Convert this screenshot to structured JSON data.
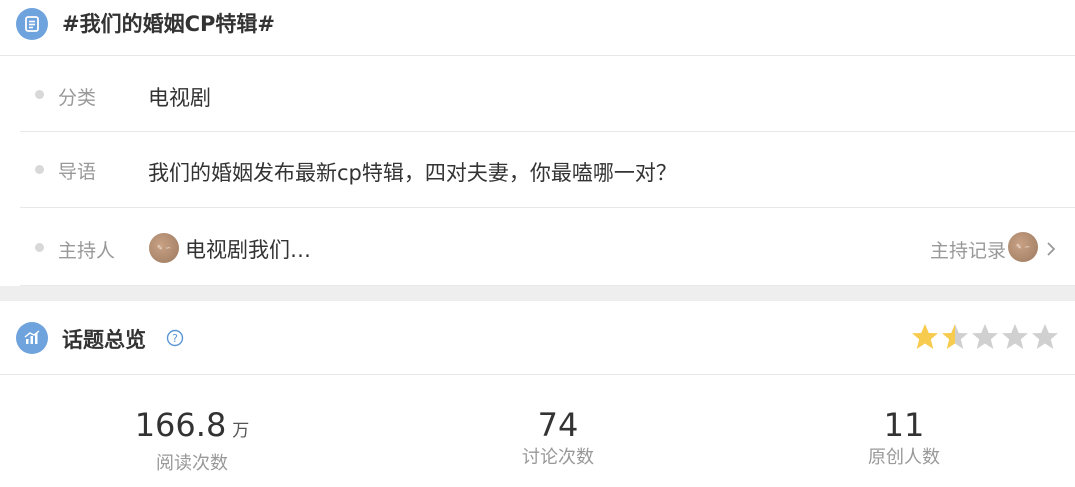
{
  "topic": {
    "title": "#我们的婚姻CP特辑#"
  },
  "info": {
    "category": {
      "label": "分类",
      "value": "电视剧"
    },
    "intro": {
      "label": "导语",
      "value": "我们的婚姻发布最新cp特辑，四对夫妻，你最嗑哪一对？"
    },
    "host": {
      "label": "主持人",
      "name": "电视剧我们…",
      "record_link": "主持记录"
    }
  },
  "overview": {
    "title": "话题总览",
    "rating_stars": 1.5,
    "rating_max": 5,
    "colors": {
      "star_on": "#f7cb4d",
      "star_off": "#d0d0d0",
      "accent": "#6fa3dd"
    },
    "stats": [
      {
        "number": "166.8",
        "unit": "万",
        "label": "阅读次数"
      },
      {
        "number": "74",
        "unit": "",
        "label": "讨论次数"
      },
      {
        "number": "11",
        "unit": "",
        "label": "原创人数"
      }
    ]
  }
}
